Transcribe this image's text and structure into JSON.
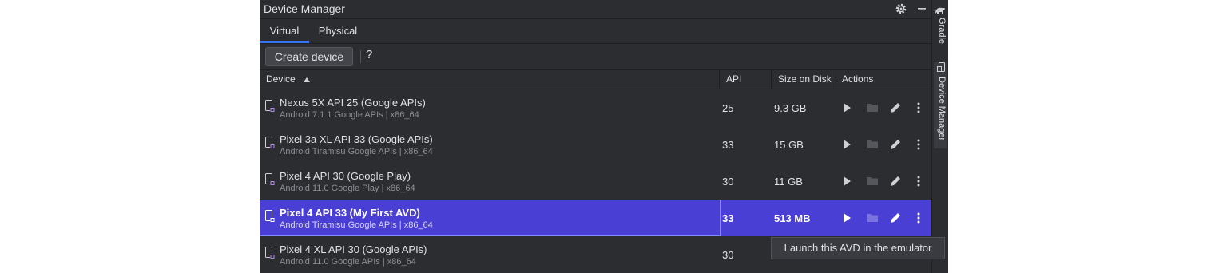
{
  "window": {
    "title": "Device Manager"
  },
  "tabs": [
    {
      "label": "Virtual",
      "active": true
    },
    {
      "label": "Physical",
      "active": false
    }
  ],
  "toolbar": {
    "create_label": "Create device",
    "help_label": "?"
  },
  "table": {
    "columns": [
      {
        "label": "Device",
        "sort": "ascending"
      },
      {
        "label": "API"
      },
      {
        "label": "Size on Disk"
      },
      {
        "label": "Actions"
      }
    ],
    "rows": [
      {
        "name": "Nexus 5X API 25 (Google APIs)",
        "details": "Android 7.1.1 Google APIs | x86_64",
        "api": "25",
        "size": "9.3 GB",
        "selected": false
      },
      {
        "name": "Pixel 3a XL API 33 (Google APIs)",
        "details": "Android Tiramisu Google APIs | x86_64",
        "api": "33",
        "size": "15 GB",
        "selected": false
      },
      {
        "name": "Pixel 4 API 30 (Google Play)",
        "details": "Android 11.0 Google Play | x86_64",
        "api": "30",
        "size": "11 GB",
        "selected": false
      },
      {
        "name": "Pixel 4 API 33 (My First AVD)",
        "details": "Android Tiramisu Google APIs | x86_64",
        "api": "33",
        "size": "513 MB",
        "selected": true
      },
      {
        "name": "Pixel 4 XL API 30 (Google APIs)",
        "details": "Android 11.0 Google APIs | x86_64",
        "api": "30",
        "size": "",
        "selected": false
      }
    ]
  },
  "tooltip": {
    "text": "Launch this AVD in the emulator"
  },
  "side_tabs": [
    {
      "label": "Gradle",
      "icon": "gradle-elephant-icon"
    },
    {
      "label": "Device Manager",
      "icon": "device-manager-icon",
      "active": true
    }
  ],
  "icons": [
    "settings-gear-icon",
    "minimize-icon",
    "sort-ascending-icon",
    "device-phone-icon",
    "play-icon",
    "folder-icon",
    "edit-pencil-icon",
    "more-vertical-icon"
  ],
  "colors": {
    "panel_bg": "#2b2d30",
    "selected_row": "#4a3fd4",
    "tab_underline": "#3574f0"
  }
}
